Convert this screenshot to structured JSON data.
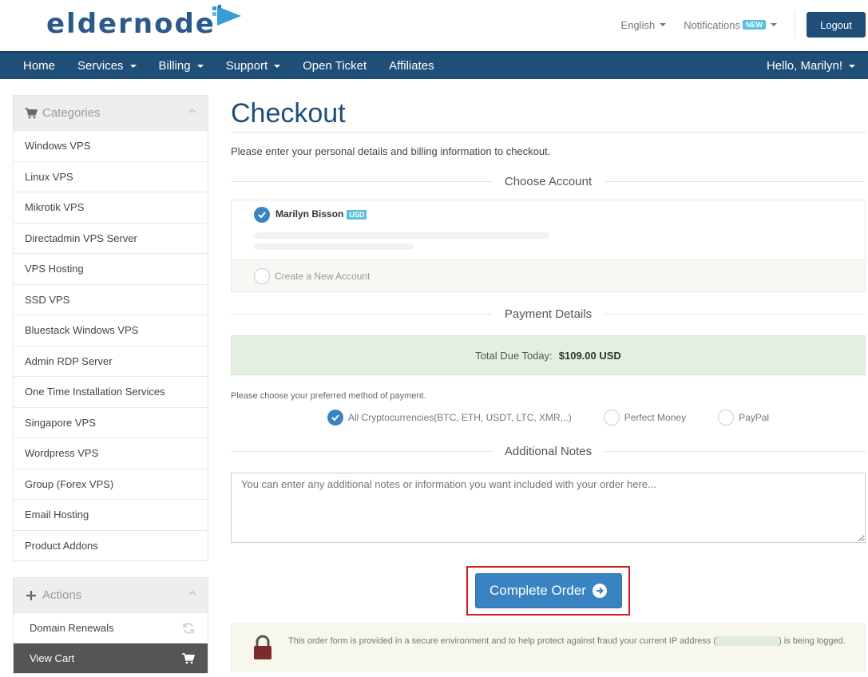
{
  "header": {
    "logo_text": "eldernode",
    "language": "English",
    "notifications": "Notifications",
    "notifications_badge": "NEW",
    "logout": "Logout"
  },
  "nav": {
    "home": "Home",
    "services": "Services",
    "billing": "Billing",
    "support": "Support",
    "open_ticket": "Open Ticket",
    "affiliates": "Affiliates",
    "user_greeting": "Hello, Marilyn!"
  },
  "sidebar": {
    "categories_title": "Categories",
    "categories": [
      "Windows VPS",
      "Linux VPS",
      "Mikrotik VPS",
      "Directadmin VPS Server",
      "VPS Hosting",
      "SSD VPS",
      "Bluestack Windows VPS",
      "Admin RDP Server",
      "One Time Installation Services",
      "Singapore VPS",
      "Wordpress VPS",
      "Group (Forex VPS)",
      "Email Hosting",
      "Product Addons"
    ],
    "actions_title": "Actions",
    "actions": [
      "Domain Renewals",
      "View Cart"
    ]
  },
  "main": {
    "title": "Checkout",
    "intro": "Please enter your personal details and billing information to checkout.",
    "choose_account": "Choose Account",
    "account_name": "Marilyn Bisson",
    "account_currency": "USD",
    "create_account": "Create a New Account",
    "payment_details": "Payment Details",
    "total_label": "Total Due Today:",
    "total_value": "$109.00 USD",
    "payment_hint": "Please choose your preferred method of payment.",
    "payment_methods": [
      "All Cryptocurrencies(BTC, ETH, USDT, LTC, XMR,..)",
      "Perfect Money",
      "PayPal"
    ],
    "additional_notes": "Additional Notes",
    "notes_placeholder": "You can enter any additional notes or information you want included with your order here...",
    "complete_order": "Complete Order",
    "secure_text_1": "This order form is provided in a secure environment and to help protect against fraud your current IP address (",
    "secure_text_2": ") is being logged."
  },
  "colors": {
    "brand": "#1f4e79",
    "primary_button": "#3a83c2",
    "highlight": "#d11e1e",
    "success_bg": "#e3f0df"
  }
}
